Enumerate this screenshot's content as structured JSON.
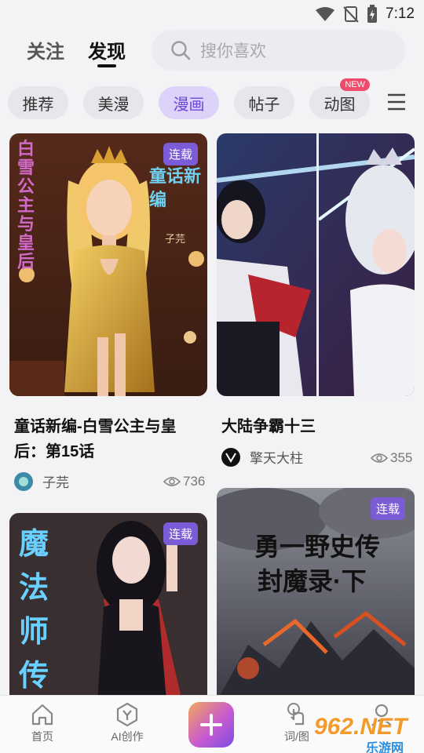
{
  "status": {
    "time": "7:12"
  },
  "top": {
    "follow": "关注",
    "discover": "发现",
    "search_placeholder": "搜你喜欢"
  },
  "categories": [
    "推荐",
    "美漫",
    "漫画",
    "帖子",
    "动图"
  ],
  "active_category": "漫画",
  "new_badge": "NEW",
  "cards": [
    {
      "tag": "连载",
      "cover_text_left": "白雪公主与皇后",
      "cover_text_right": "童话新编",
      "cover_signature": "子芫",
      "title_line1": "童话新编-白雪公主与皇",
      "title_line2": "后：第15话",
      "author": "子芫",
      "views": "736"
    },
    {
      "title": "大陆争霸十三",
      "author": "擎天大柱",
      "views": "355"
    },
    {
      "tag": "连载",
      "cover_text": "魔法师传"
    },
    {
      "tag": "连载",
      "cover_line1": "勇一野史传",
      "cover_line2": "封魔录·下"
    }
  ],
  "nav": {
    "home": "首页",
    "ai": "AI创作",
    "word": "词/图"
  },
  "watermark": {
    "top": "962.NET",
    "bottom": "乐游网"
  },
  "colors": {
    "accent": "#7b5bd6",
    "active_chip_bg": "#ddd2fa",
    "badge": "#f04a6a"
  }
}
